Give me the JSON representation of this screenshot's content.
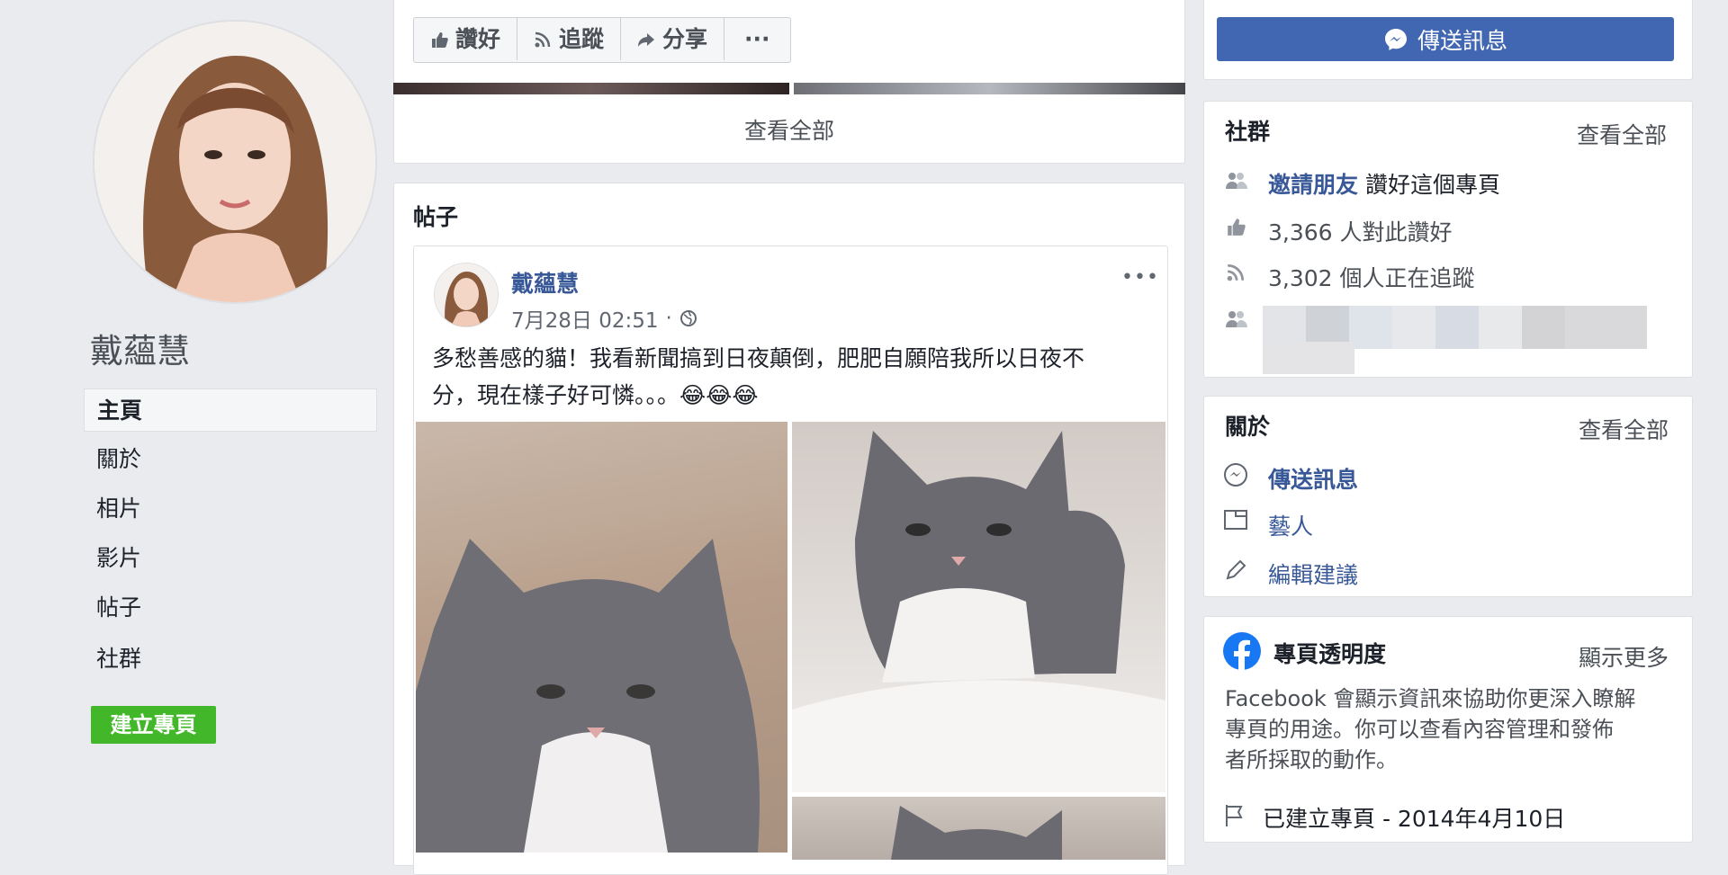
{
  "profile": {
    "name": "戴蘊慧"
  },
  "nav": {
    "items": [
      {
        "label": "主頁",
        "active": true
      },
      {
        "label": "關於"
      },
      {
        "label": "相片"
      },
      {
        "label": "影片"
      },
      {
        "label": "帖子"
      },
      {
        "label": "社群"
      }
    ],
    "create_page": "建立專頁"
  },
  "actions": {
    "like": "讚好",
    "follow": "追蹤",
    "share": "分享",
    "more": "···"
  },
  "message_button": "傳送訊息",
  "photos_card": {
    "see_all": "查看全部"
  },
  "posts": {
    "heading": "帖子",
    "post": {
      "author": "戴蘊慧",
      "time": "7月28日 02:51",
      "dot": "·",
      "text_line1": "多愁善感的貓！我看新聞搞到日夜顛倒，肥肥自願陪我所以日夜不",
      "text_line2": "分，現在樣子好可憐。。。😂😂😂",
      "menu": "•••"
    }
  },
  "community": {
    "title": "社群",
    "see_all": "查看全部",
    "invite_link": "邀請朋友",
    "invite_rest": " 讚好這個專頁",
    "likes": "3,366 人對此讚好",
    "follows": "3,302 個人正在追蹤"
  },
  "about": {
    "title": "關於",
    "see_all": "查看全部",
    "send_message": "傳送訊息",
    "category": "藝人",
    "edit": "編輯建議"
  },
  "transparency": {
    "title": "專頁透明度",
    "show_more": "顯示更多",
    "line1": "Facebook 會顯示資訊來協助你更深入瞭解",
    "line2": "專頁的用途。你可以查看內容管理和發佈",
    "line3": "者所採取的動作。",
    "created": "已建立專頁 - 2014年4月10日"
  },
  "colors": {
    "accent": "#4267b2",
    "link": "#385898",
    "green": "#42b72a",
    "bg": "#e9ebee"
  }
}
